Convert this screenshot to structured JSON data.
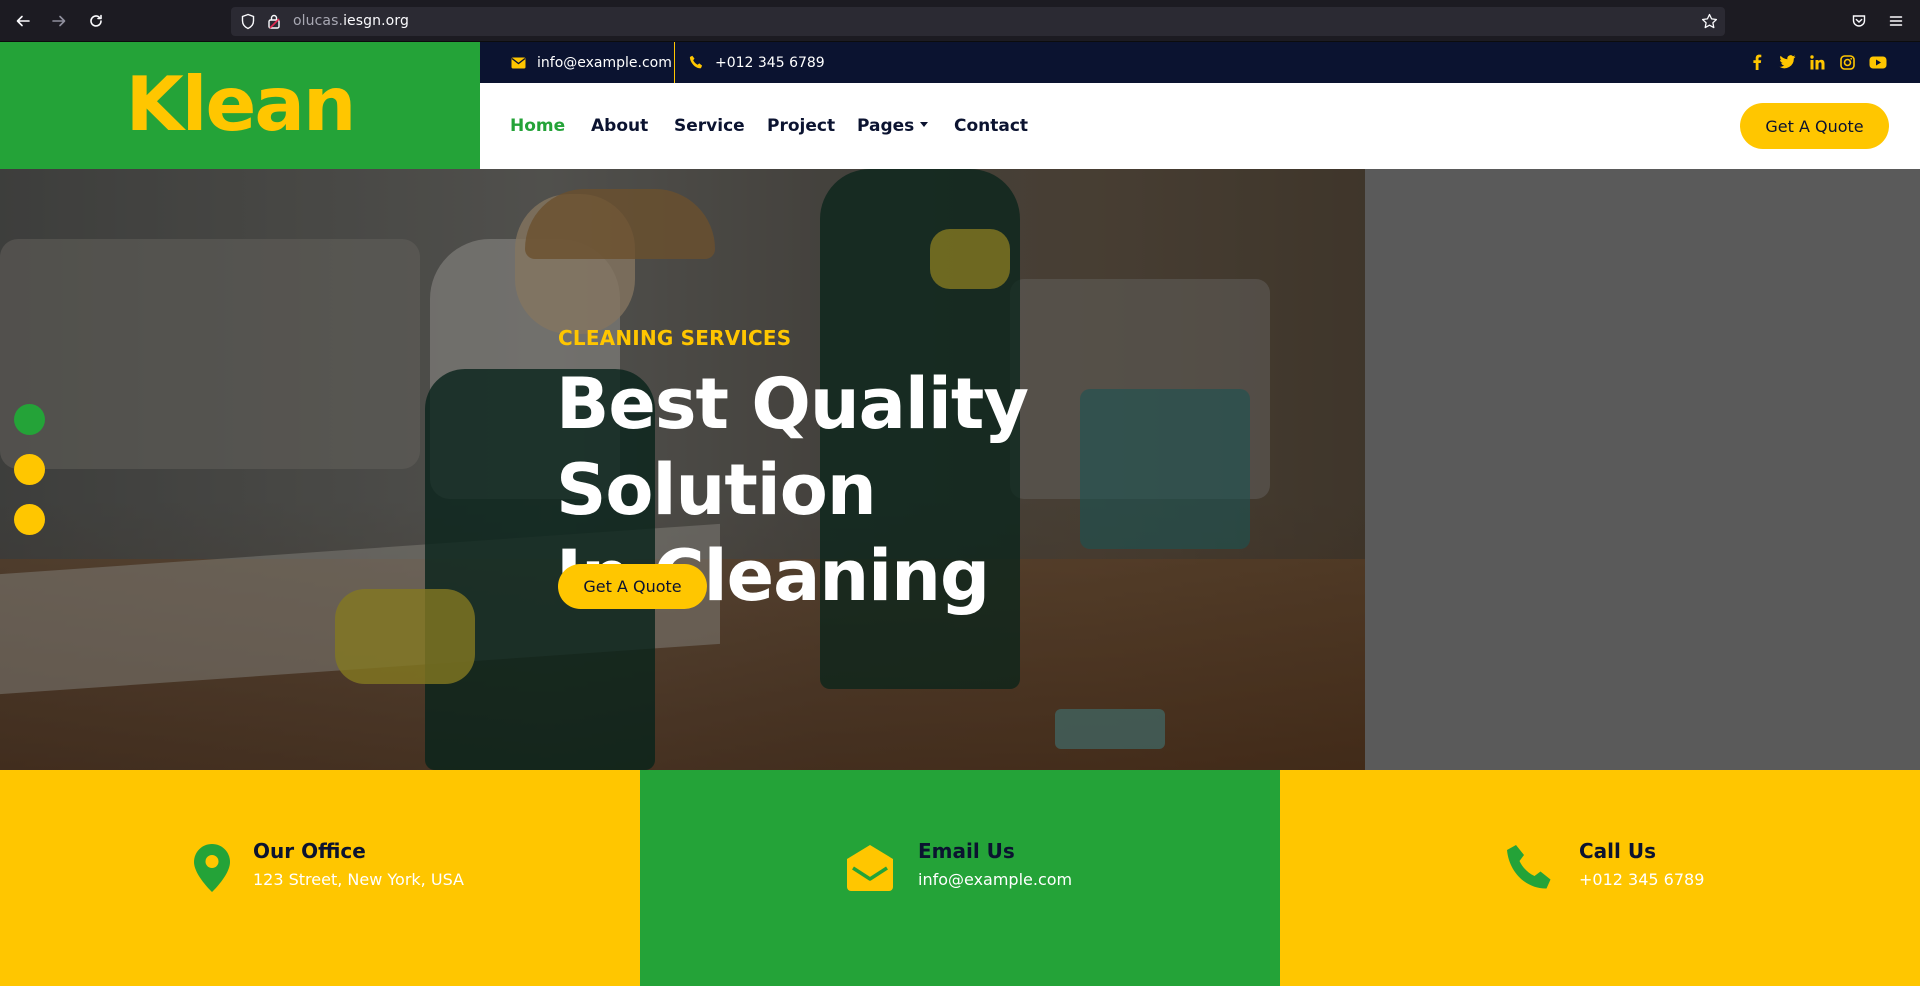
{
  "browser": {
    "url_domain": "olucas.",
    "url_host": "iesgn.org",
    "icons": [
      "back-arrow-icon",
      "forward-arrow-icon",
      "reload-icon",
      "shield-icon",
      "lock-icon",
      "star-icon",
      "pocket-icon",
      "menu-icon"
    ]
  },
  "brand": {
    "logo_text": "Klean"
  },
  "topbar": {
    "email": "info@example.com",
    "phone": "+012 345 6789",
    "socials": [
      "facebook-icon",
      "twitter-icon",
      "linkedin-icon",
      "instagram-icon",
      "youtube-icon"
    ]
  },
  "nav": {
    "items": [
      {
        "label": "Home"
      },
      {
        "label": "About"
      },
      {
        "label": "Service"
      },
      {
        "label": "Project"
      },
      {
        "label": "Pages"
      },
      {
        "label": "Contact"
      }
    ],
    "cta": "Get A Quote"
  },
  "hero": {
    "kicker": "CLEANING SERVICES",
    "title_line1": "Best Quality Solution",
    "title_line2": "In Cleaning",
    "cta": "Get A Quote",
    "slides": 3,
    "active_slide": 1
  },
  "contact": [
    {
      "title": "Our Office",
      "sub": "123 Street, New York, USA",
      "icon": "map-pin-icon"
    },
    {
      "title": "Email Us",
      "sub": "info@example.com",
      "icon": "envelope-open-icon"
    },
    {
      "title": "Call Us",
      "sub": "+012 345 6789",
      "icon": "phone-icon"
    }
  ],
  "colors": {
    "green": "#24a338",
    "yellow": "#ffc600",
    "navy": "#0b1330"
  }
}
